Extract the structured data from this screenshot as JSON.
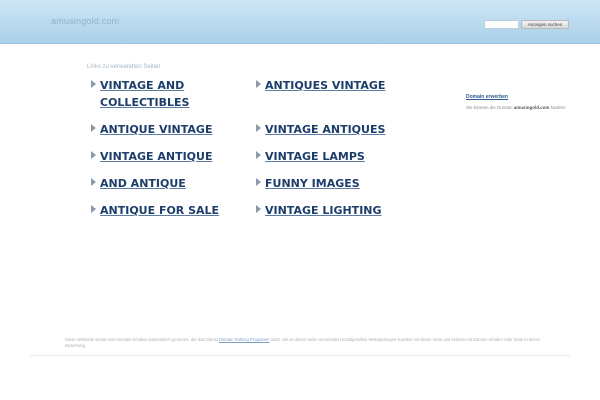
{
  "header": {
    "site_title": "amusingold.com",
    "search_placeholder": "",
    "search_button_label": "Anzeigen suchen"
  },
  "links": {
    "heading": "Links zu verwandten Seiten",
    "left_column": [
      {
        "line1": "VINTAGE AND",
        "line2": "COLLECTIBLES"
      },
      {
        "line1": "ANTIQUE VINTAGE"
      },
      {
        "line1": "VINTAGE ANTIQUE"
      },
      {
        "line1": "AND ANTIQUE"
      },
      {
        "line1": "ANTIQUE FOR SALE"
      }
    ],
    "right_column": [
      {
        "line1": "ANTIQUES VINTAGE"
      },
      {
        "line1": "VINTAGE ANTIQUES"
      },
      {
        "line1": "VINTAGE LAMPS"
      },
      {
        "line1": "FUNNY IMAGES"
      },
      {
        "line1": "VINTAGE LIGHTING"
      }
    ]
  },
  "domain_box": {
    "title": "Domain erwerben",
    "text_before": "Sie können die Domain",
    "domain": "amusingold.com",
    "text_after": "kaufen!"
  },
  "footer": {
    "text_before": "Diese Webseite wurde vom Domain-Inhaber automatisch generiert, der das Dienst",
    "link": "Domain Parking Programm",
    "text_after": "nutzt. Sie ist dieser Seite commentiert kostbpendtes Verknüpfungen-Kunden mit dieser Seite und keinem mit Domain-Inhaber oder Seite in keiner Beziehung."
  }
}
